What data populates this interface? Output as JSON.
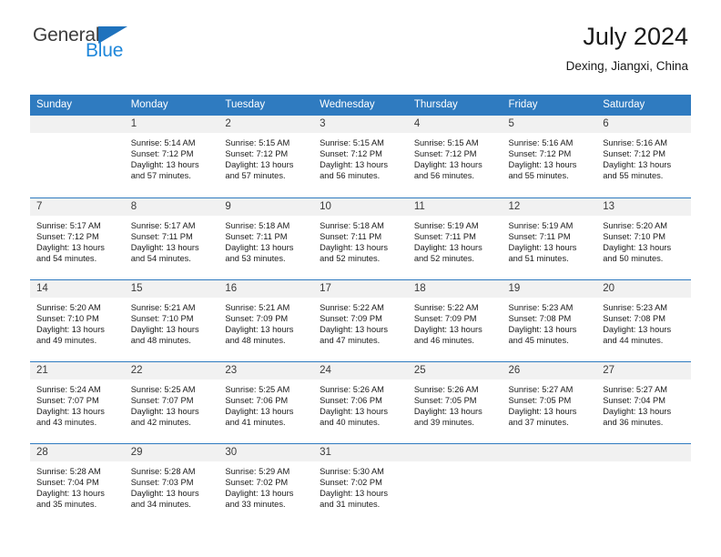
{
  "brand": {
    "name_part1": "General",
    "name_part2": "Blue",
    "triangle_icon": "triangle-icon",
    "accent_color": "#1f72bd",
    "blue_text_color": "#1f87da"
  },
  "header": {
    "title": "July 2024",
    "subtitle": "Dexing, Jiangxi, China"
  },
  "theme": {
    "header_bg": "#2f7bc0",
    "daynum_bg": "#f1f1f1",
    "grid_line": "#2f7bc0"
  },
  "weekdays": [
    "Sunday",
    "Monday",
    "Tuesday",
    "Wednesday",
    "Thursday",
    "Friday",
    "Saturday"
  ],
  "weeks": [
    [
      {
        "day": "",
        "blank": true,
        "sunrise": "",
        "sunset": "",
        "daylight_line1": "",
        "daylight_line2": ""
      },
      {
        "day": "1",
        "sunrise": "Sunrise: 5:14 AM",
        "sunset": "Sunset: 7:12 PM",
        "daylight_line1": "Daylight: 13 hours",
        "daylight_line2": "and 57 minutes."
      },
      {
        "day": "2",
        "sunrise": "Sunrise: 5:15 AM",
        "sunset": "Sunset: 7:12 PM",
        "daylight_line1": "Daylight: 13 hours",
        "daylight_line2": "and 57 minutes."
      },
      {
        "day": "3",
        "sunrise": "Sunrise: 5:15 AM",
        "sunset": "Sunset: 7:12 PM",
        "daylight_line1": "Daylight: 13 hours",
        "daylight_line2": "and 56 minutes."
      },
      {
        "day": "4",
        "sunrise": "Sunrise: 5:15 AM",
        "sunset": "Sunset: 7:12 PM",
        "daylight_line1": "Daylight: 13 hours",
        "daylight_line2": "and 56 minutes."
      },
      {
        "day": "5",
        "sunrise": "Sunrise: 5:16 AM",
        "sunset": "Sunset: 7:12 PM",
        "daylight_line1": "Daylight: 13 hours",
        "daylight_line2": "and 55 minutes."
      },
      {
        "day": "6",
        "sunrise": "Sunrise: 5:16 AM",
        "sunset": "Sunset: 7:12 PM",
        "daylight_line1": "Daylight: 13 hours",
        "daylight_line2": "and 55 minutes."
      }
    ],
    [
      {
        "day": "7",
        "sunrise": "Sunrise: 5:17 AM",
        "sunset": "Sunset: 7:12 PM",
        "daylight_line1": "Daylight: 13 hours",
        "daylight_line2": "and 54 minutes."
      },
      {
        "day": "8",
        "sunrise": "Sunrise: 5:17 AM",
        "sunset": "Sunset: 7:11 PM",
        "daylight_line1": "Daylight: 13 hours",
        "daylight_line2": "and 54 minutes."
      },
      {
        "day": "9",
        "sunrise": "Sunrise: 5:18 AM",
        "sunset": "Sunset: 7:11 PM",
        "daylight_line1": "Daylight: 13 hours",
        "daylight_line2": "and 53 minutes."
      },
      {
        "day": "10",
        "sunrise": "Sunrise: 5:18 AM",
        "sunset": "Sunset: 7:11 PM",
        "daylight_line1": "Daylight: 13 hours",
        "daylight_line2": "and 52 minutes."
      },
      {
        "day": "11",
        "sunrise": "Sunrise: 5:19 AM",
        "sunset": "Sunset: 7:11 PM",
        "daylight_line1": "Daylight: 13 hours",
        "daylight_line2": "and 52 minutes."
      },
      {
        "day": "12",
        "sunrise": "Sunrise: 5:19 AM",
        "sunset": "Sunset: 7:11 PM",
        "daylight_line1": "Daylight: 13 hours",
        "daylight_line2": "and 51 minutes."
      },
      {
        "day": "13",
        "sunrise": "Sunrise: 5:20 AM",
        "sunset": "Sunset: 7:10 PM",
        "daylight_line1": "Daylight: 13 hours",
        "daylight_line2": "and 50 minutes."
      }
    ],
    [
      {
        "day": "14",
        "sunrise": "Sunrise: 5:20 AM",
        "sunset": "Sunset: 7:10 PM",
        "daylight_line1": "Daylight: 13 hours",
        "daylight_line2": "and 49 minutes."
      },
      {
        "day": "15",
        "sunrise": "Sunrise: 5:21 AM",
        "sunset": "Sunset: 7:10 PM",
        "daylight_line1": "Daylight: 13 hours",
        "daylight_line2": "and 48 minutes."
      },
      {
        "day": "16",
        "sunrise": "Sunrise: 5:21 AM",
        "sunset": "Sunset: 7:09 PM",
        "daylight_line1": "Daylight: 13 hours",
        "daylight_line2": "and 48 minutes."
      },
      {
        "day": "17",
        "sunrise": "Sunrise: 5:22 AM",
        "sunset": "Sunset: 7:09 PM",
        "daylight_line1": "Daylight: 13 hours",
        "daylight_line2": "and 47 minutes."
      },
      {
        "day": "18",
        "sunrise": "Sunrise: 5:22 AM",
        "sunset": "Sunset: 7:09 PM",
        "daylight_line1": "Daylight: 13 hours",
        "daylight_line2": "and 46 minutes."
      },
      {
        "day": "19",
        "sunrise": "Sunrise: 5:23 AM",
        "sunset": "Sunset: 7:08 PM",
        "daylight_line1": "Daylight: 13 hours",
        "daylight_line2": "and 45 minutes."
      },
      {
        "day": "20",
        "sunrise": "Sunrise: 5:23 AM",
        "sunset": "Sunset: 7:08 PM",
        "daylight_line1": "Daylight: 13 hours",
        "daylight_line2": "and 44 minutes."
      }
    ],
    [
      {
        "day": "21",
        "sunrise": "Sunrise: 5:24 AM",
        "sunset": "Sunset: 7:07 PM",
        "daylight_line1": "Daylight: 13 hours",
        "daylight_line2": "and 43 minutes."
      },
      {
        "day": "22",
        "sunrise": "Sunrise: 5:25 AM",
        "sunset": "Sunset: 7:07 PM",
        "daylight_line1": "Daylight: 13 hours",
        "daylight_line2": "and 42 minutes."
      },
      {
        "day": "23",
        "sunrise": "Sunrise: 5:25 AM",
        "sunset": "Sunset: 7:06 PM",
        "daylight_line1": "Daylight: 13 hours",
        "daylight_line2": "and 41 minutes."
      },
      {
        "day": "24",
        "sunrise": "Sunrise: 5:26 AM",
        "sunset": "Sunset: 7:06 PM",
        "daylight_line1": "Daylight: 13 hours",
        "daylight_line2": "and 40 minutes."
      },
      {
        "day": "25",
        "sunrise": "Sunrise: 5:26 AM",
        "sunset": "Sunset: 7:05 PM",
        "daylight_line1": "Daylight: 13 hours",
        "daylight_line2": "and 39 minutes."
      },
      {
        "day": "26",
        "sunrise": "Sunrise: 5:27 AM",
        "sunset": "Sunset: 7:05 PM",
        "daylight_line1": "Daylight: 13 hours",
        "daylight_line2": "and 37 minutes."
      },
      {
        "day": "27",
        "sunrise": "Sunrise: 5:27 AM",
        "sunset": "Sunset: 7:04 PM",
        "daylight_line1": "Daylight: 13 hours",
        "daylight_line2": "and 36 minutes."
      }
    ],
    [
      {
        "day": "28",
        "sunrise": "Sunrise: 5:28 AM",
        "sunset": "Sunset: 7:04 PM",
        "daylight_line1": "Daylight: 13 hours",
        "daylight_line2": "and 35 minutes."
      },
      {
        "day": "29",
        "sunrise": "Sunrise: 5:28 AM",
        "sunset": "Sunset: 7:03 PM",
        "daylight_line1": "Daylight: 13 hours",
        "daylight_line2": "and 34 minutes."
      },
      {
        "day": "30",
        "sunrise": "Sunrise: 5:29 AM",
        "sunset": "Sunset: 7:02 PM",
        "daylight_line1": "Daylight: 13 hours",
        "daylight_line2": "and 33 minutes."
      },
      {
        "day": "31",
        "sunrise": "Sunrise: 5:30 AM",
        "sunset": "Sunset: 7:02 PM",
        "daylight_line1": "Daylight: 13 hours",
        "daylight_line2": "and 31 minutes."
      },
      {
        "day": "",
        "blank": true,
        "sunrise": "",
        "sunset": "",
        "daylight_line1": "",
        "daylight_line2": ""
      },
      {
        "day": "",
        "blank": true,
        "sunrise": "",
        "sunset": "",
        "daylight_line1": "",
        "daylight_line2": ""
      },
      {
        "day": "",
        "blank": true,
        "sunrise": "",
        "sunset": "",
        "daylight_line1": "",
        "daylight_line2": ""
      }
    ]
  ]
}
